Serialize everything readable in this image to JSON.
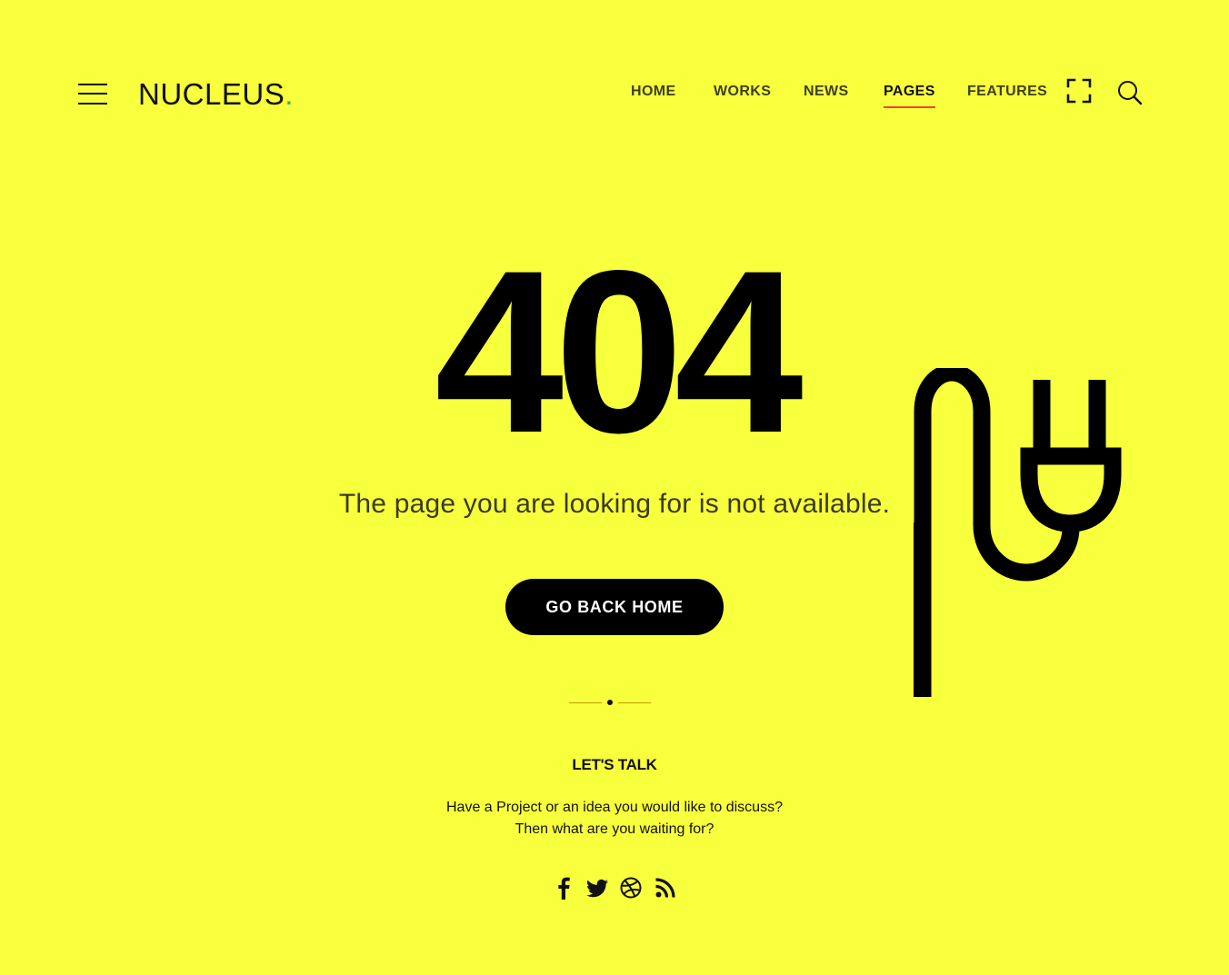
{
  "header": {
    "logo": {
      "text": "NUCLEUS",
      "suffix": "."
    },
    "nav": [
      {
        "label": "HOME",
        "active": false
      },
      {
        "label": "WORKS",
        "active": false
      },
      {
        "label": "NEWS",
        "active": false
      },
      {
        "label": "PAGES",
        "active": true
      },
      {
        "label": "FEATURES",
        "active": false
      }
    ],
    "icons": [
      {
        "name": "menu-icon"
      },
      {
        "name": "fullscreen-icon"
      },
      {
        "name": "search-icon"
      }
    ]
  },
  "main": {
    "code": "404",
    "message": "The page you are looking for is not available.",
    "button_label": "GO BACK HOME",
    "illustration": "plug-icon"
  },
  "footer": {
    "title": "LET'S TALK",
    "line1": "Have a Project or an idea you would like to discuss?",
    "line2": "Then what are you waiting for?",
    "social_icons": [
      "facebook-icon",
      "twitter-icon",
      "dribbble-icon",
      "rss-icon"
    ]
  },
  "colors": {
    "background": "#f8ff3c",
    "primary_text": "#000000",
    "logo_accent": "#38b24a",
    "nav_active_underline": "#f24234",
    "button_background": "#000000",
    "button_text": "#ffffff"
  }
}
